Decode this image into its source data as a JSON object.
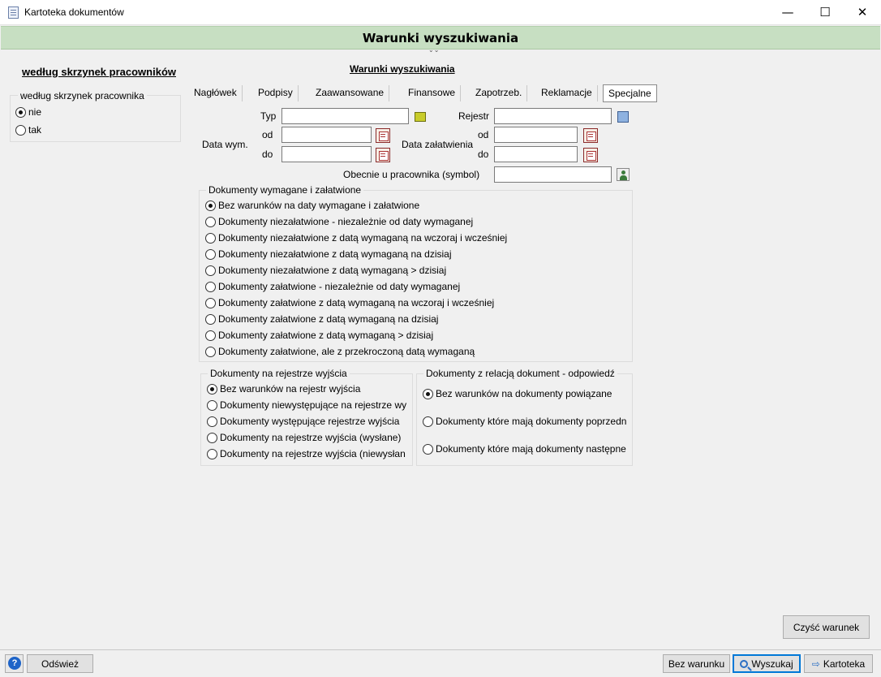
{
  "window": {
    "title": "Kartoteka dokumentów",
    "minimize": "—",
    "maximize": "☐",
    "close": "✕"
  },
  "header": {
    "title": "Warunki wyszukiwania"
  },
  "left": {
    "title": "według skrzynek pracowników",
    "group_label": "według skrzynek pracownika",
    "options": [
      {
        "label": "nie",
        "checked": true
      },
      {
        "label": "tak",
        "checked": false
      }
    ]
  },
  "center_title": "Warunki wyszukiwania",
  "tabs": [
    {
      "label": "Nagłówek"
    },
    {
      "label": "Podpisy"
    },
    {
      "label": "Zaawansowane"
    },
    {
      "label": "Finansowe"
    },
    {
      "label": "Zapotrzeb."
    },
    {
      "label": "Reklamacje"
    },
    {
      "label": "Specjalne",
      "active": true
    }
  ],
  "form": {
    "typ_label": "Typ",
    "typ_value": "",
    "rejestr_label": "Rejestr",
    "rejestr_value": "",
    "data_wym_label": "Data wym.",
    "data_zal_label": "Data załatwienia",
    "od_label": "od",
    "do_label": "do",
    "wym_od": "",
    "wym_do": "",
    "zal_od": "",
    "zal_do": "",
    "obecnie_label": "Obecnie u pracownika (symbol)",
    "obecnie_value": ""
  },
  "group_wymagane": {
    "legend": "Dokumenty wymagane i załatwione",
    "options": [
      {
        "label": "Bez warunków na daty wymagane i załatwione",
        "checked": true
      },
      {
        "label": "Dokumenty niezałatwione - niezależnie od daty wymaganej",
        "checked": false
      },
      {
        "label": "Dokumenty niezałatwione z datą wymaganą na wczoraj i wcześniej",
        "checked": false
      },
      {
        "label": "Dokumenty niezałatwione z datą wymaganą na dzisiaj",
        "checked": false
      },
      {
        "label": "Dokumenty niezałatwione z datą wymaganą > dzisiaj",
        "checked": false
      },
      {
        "label": "Dokumenty załatwione - niezależnie od daty wymaganej",
        "checked": false
      },
      {
        "label": "Dokumenty załatwione z datą wymaganą na wczoraj i wcześniej",
        "checked": false
      },
      {
        "label": "Dokumenty załatwione z datą wymaganą na dzisiaj",
        "checked": false
      },
      {
        "label": "Dokumenty załatwione z datą wymaganą > dzisiaj",
        "checked": false
      },
      {
        "label": "Dokumenty załatwione, ale z przekroczoną datą wymaganą",
        "checked": false
      }
    ]
  },
  "group_rejestr": {
    "legend": "Dokumenty na rejestrze wyjścia",
    "options": [
      {
        "label": "Bez warunków na rejestr wyjścia",
        "checked": true
      },
      {
        "label": "Dokumenty niewystępujące na rejestrze wy",
        "checked": false
      },
      {
        "label": "Dokumenty występujące rejestrze wyjścia",
        "checked": false
      },
      {
        "label": "Dokumenty na rejestrze wyjścia (wysłane)",
        "checked": false
      },
      {
        "label": "Dokumenty na rejestrze wyjścia (niewysłan",
        "checked": false
      }
    ]
  },
  "group_relacja": {
    "legend": "Dokumenty z relacją dokument - odpowiedź",
    "options": [
      {
        "label": "Bez warunków na dokumenty powiązane",
        "checked": true
      },
      {
        "label": "Dokumenty które mają dokumenty poprzedn",
        "checked": false
      },
      {
        "label": "Dokumenty które mają dokumenty następne",
        "checked": false
      }
    ]
  },
  "buttons": {
    "clear": "Czyść warunek",
    "help": "?",
    "refresh": "Odśwież",
    "no_condition": "Bez warunku",
    "search": "Wyszukaj",
    "kartoteka": "Kartoteka"
  }
}
